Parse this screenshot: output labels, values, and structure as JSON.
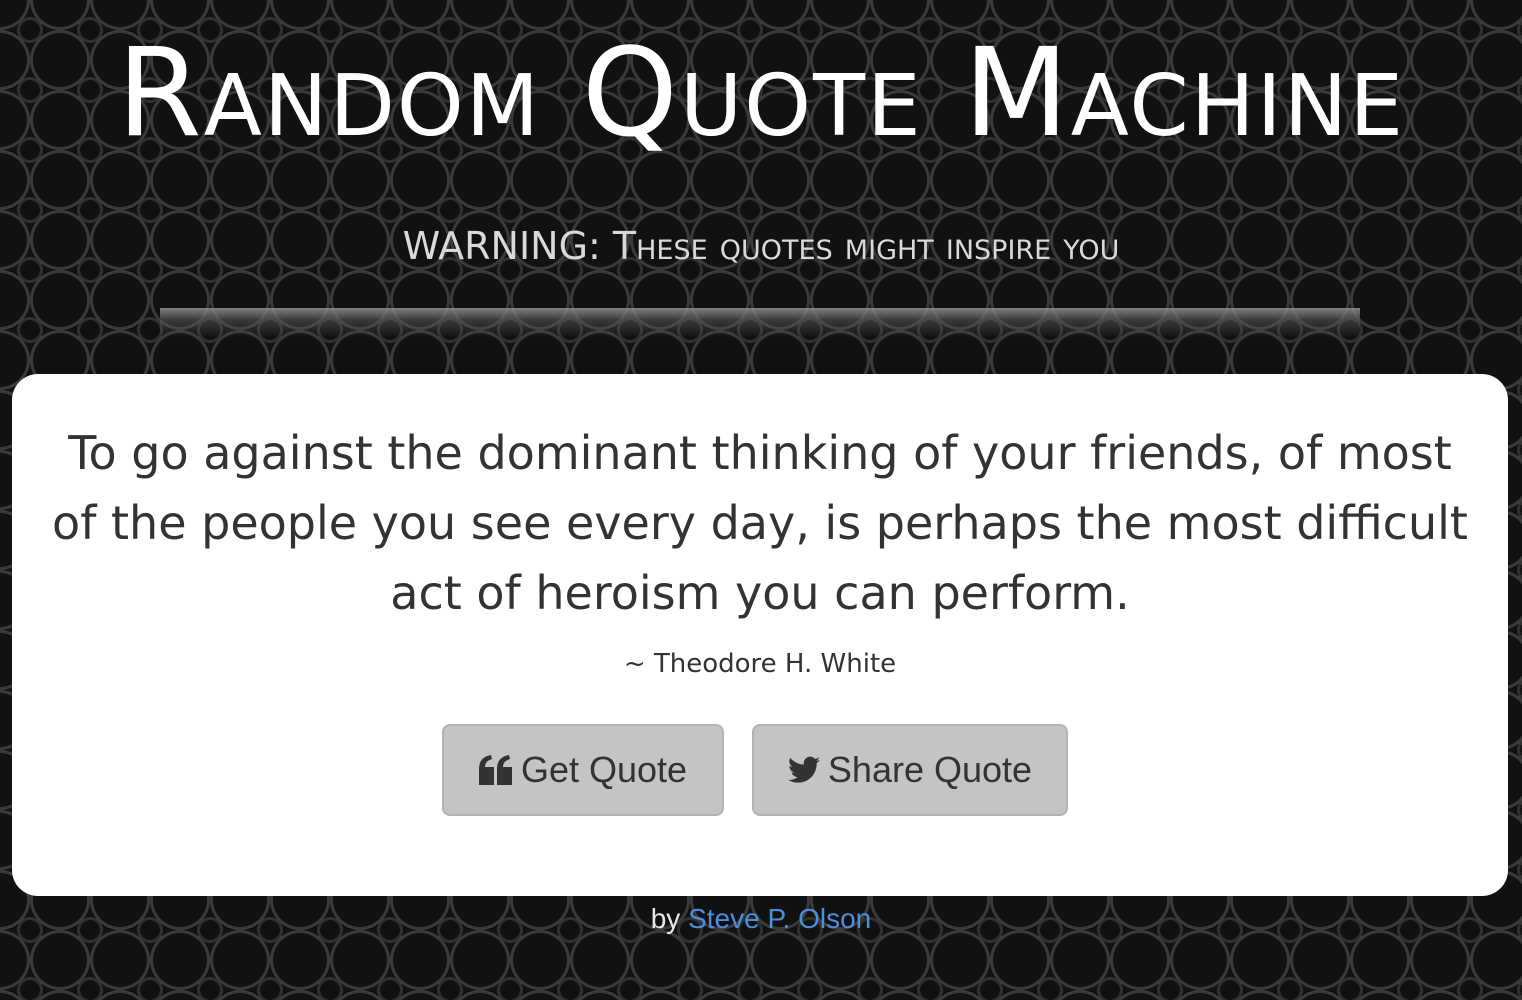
{
  "header": {
    "title": "Random Quote Machine",
    "subtitle": "WARNING: These quotes might inspire you"
  },
  "quote": {
    "text": "To go against the dominant thinking of your friends, of most of the people you see every day, is perhaps the most difficult act of heroism you can perform.",
    "author": "~ Theodore H. White"
  },
  "buttons": {
    "get_quote_label": "Get Quote",
    "get_quote_icon": "quote-left-icon",
    "share_quote_label": "Share Quote",
    "share_quote_icon": "twitter-icon"
  },
  "footer": {
    "prefix": "by",
    "author_link": "Steve P. Olson"
  },
  "colors": {
    "background": "#111111",
    "card": "#ffffff",
    "button": "#c4c4c4",
    "link": "#4a90d9",
    "text": "#333333"
  }
}
